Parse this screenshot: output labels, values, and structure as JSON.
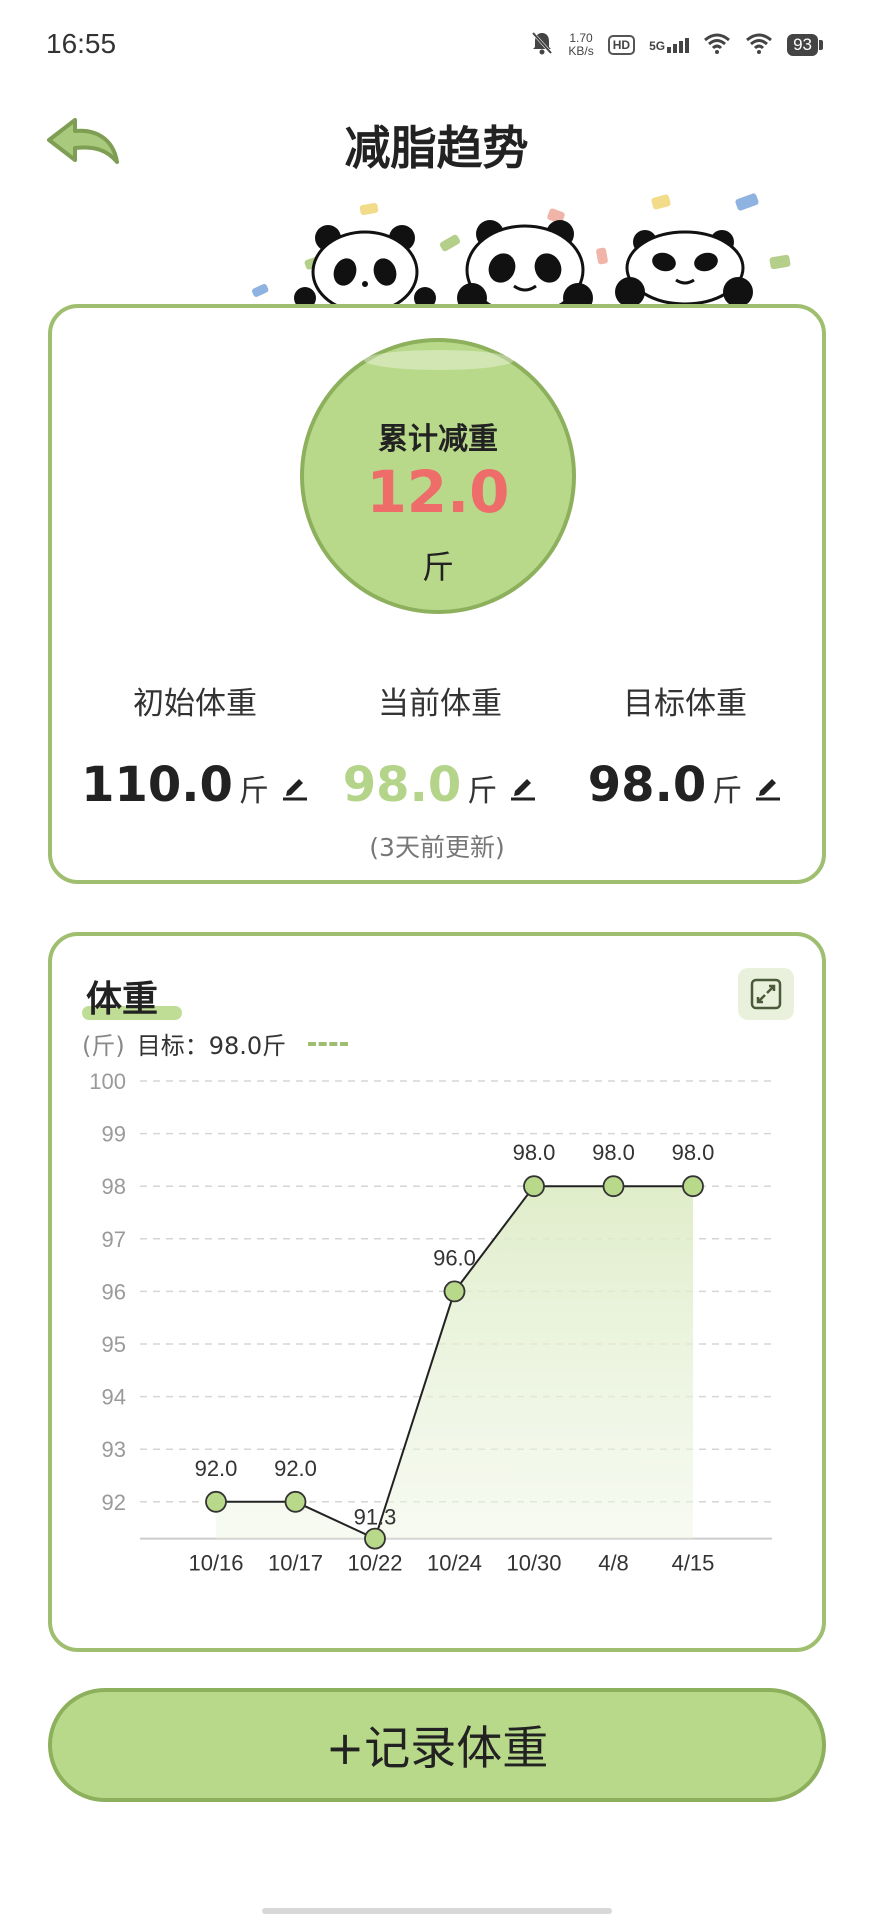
{
  "status_bar": {
    "time": "16:55",
    "net_speed_value": "1.70",
    "net_speed_unit": "KB/s",
    "hd_label": "HD",
    "network_label": "5G",
    "battery": "93"
  },
  "header": {
    "title": "减脂趋势",
    "back_icon": "back-arrow-icon"
  },
  "summary": {
    "loss_label": "累计减重",
    "loss_value": "12.0",
    "loss_unit": "斤",
    "initial": {
      "label": "初始体重",
      "value": "110.0",
      "unit": "斤"
    },
    "current": {
      "label": "当前体重",
      "value": "98.0",
      "unit": "斤"
    },
    "target": {
      "label": "目标体重",
      "value": "98.0",
      "unit": "斤"
    },
    "updated_note": "(3天前更新)",
    "colors": {
      "accent": "#b8d98a",
      "border": "#9fbe6f",
      "loss_value": "#ee6c6a"
    }
  },
  "chart_card": {
    "title": "体重",
    "unit_label": "(斤)",
    "target_legend": "目标：98.0斤",
    "expand_icon": "expand-icon"
  },
  "chart_data": {
    "type": "line",
    "categories": [
      "10/16",
      "10/17",
      "10/22",
      "10/24",
      "10/30",
      "4/8",
      "4/15"
    ],
    "series": [
      {
        "values": [
          92.0,
          92.0,
          91.3,
          96.0,
          98.0,
          98.0,
          98.0
        ],
        "labels": [
          "92.0",
          "92.0",
          "91.3",
          "96.0",
          "98.0",
          "98.0",
          "98.0"
        ]
      }
    ],
    "y_ticks": [
      100,
      99,
      98,
      97,
      96,
      95,
      94,
      93,
      92
    ],
    "ylim": [
      91.3,
      100
    ],
    "grid": true,
    "target": 98.0
  },
  "record_button": {
    "label": "+记录体重"
  }
}
